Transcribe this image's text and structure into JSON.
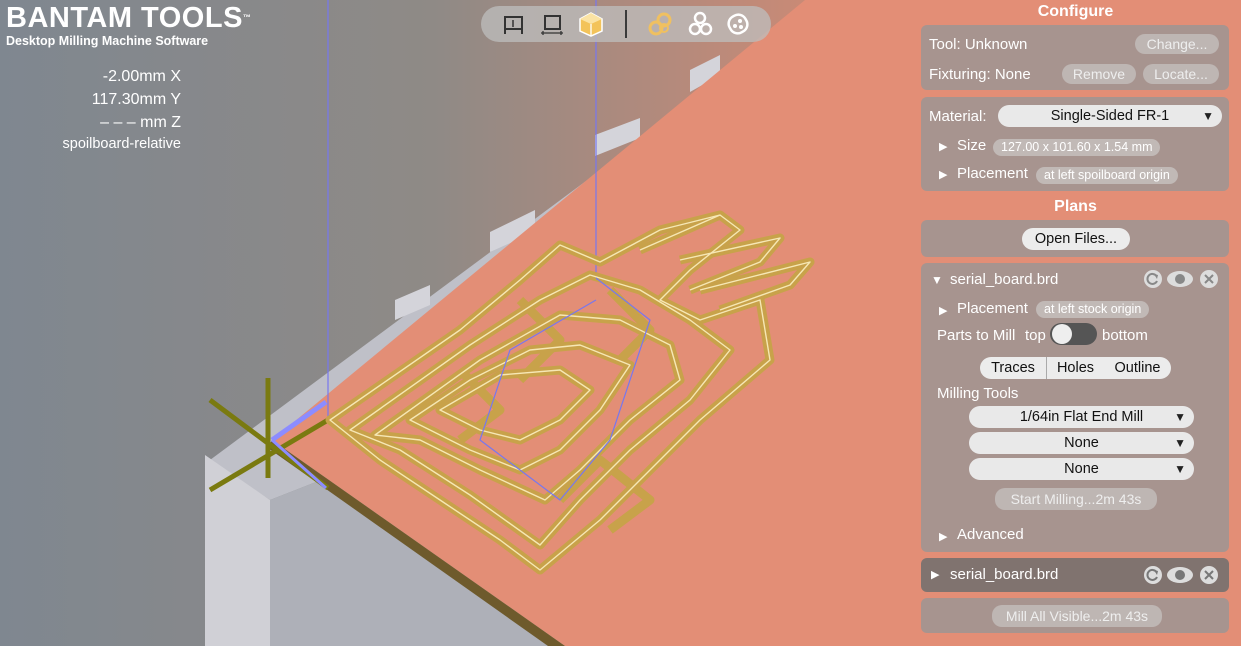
{
  "brand": {
    "title": "BANTAM TOOLS",
    "trademark": "™",
    "subtitle": "Desktop Milling Machine Software"
  },
  "coords": {
    "x": "-2.00mm X",
    "y": "117.30mm Y",
    "z": "– – – mm Z",
    "mode": "spoilboard-relative"
  },
  "view_toolbar": {
    "buttons": [
      {
        "icon": "front-view-icon",
        "active": false
      },
      {
        "icon": "top-view-icon",
        "active": false
      },
      {
        "icon": "iso-view-icon",
        "active": true
      },
      {
        "icon": "traces-visibility-icon",
        "active": true
      },
      {
        "icon": "holes-visibility-icon",
        "active": false
      },
      {
        "icon": "stock-visibility-icon",
        "active": false
      }
    ]
  },
  "configure": {
    "title": "Configure",
    "tool_label": "Tool: Unknown",
    "change_button": "Change...",
    "fixturing_label": "Fixturing: None",
    "remove_button": "Remove",
    "locate_button": "Locate...",
    "material_label": "Material:",
    "material_value": "Single-Sided FR-1",
    "size_label": "Size",
    "size_value": "127.00 x 101.60 x 1.54 mm",
    "placement_label": "Placement",
    "placement_value": "at left spoilboard origin"
  },
  "plans": {
    "title": "Plans",
    "open_files_button": "Open Files...",
    "plan1": {
      "filename": "serial_board.brd",
      "placement_label": "Placement",
      "placement_value": "at left stock origin",
      "parts_label": "Parts to Mill",
      "parts_top": "top",
      "parts_bottom": "bottom",
      "tabs": [
        "Traces",
        "Holes",
        "Outline"
      ],
      "milling_tools_label": "Milling Tools",
      "tools": [
        "1/64in Flat End Mill",
        "None",
        "None"
      ],
      "start_button": "Start Milling...2m 43s",
      "advanced_label": "Advanced"
    },
    "plan2": {
      "filename": "serial_board.brd"
    },
    "mill_all_button": "Mill All Visible...2m 43s"
  },
  "colors": {
    "accent": "#f0c060",
    "trace_gold": "#c8a24a",
    "stock": "#e8957b",
    "spoilboard": "#c9c9d0"
  }
}
